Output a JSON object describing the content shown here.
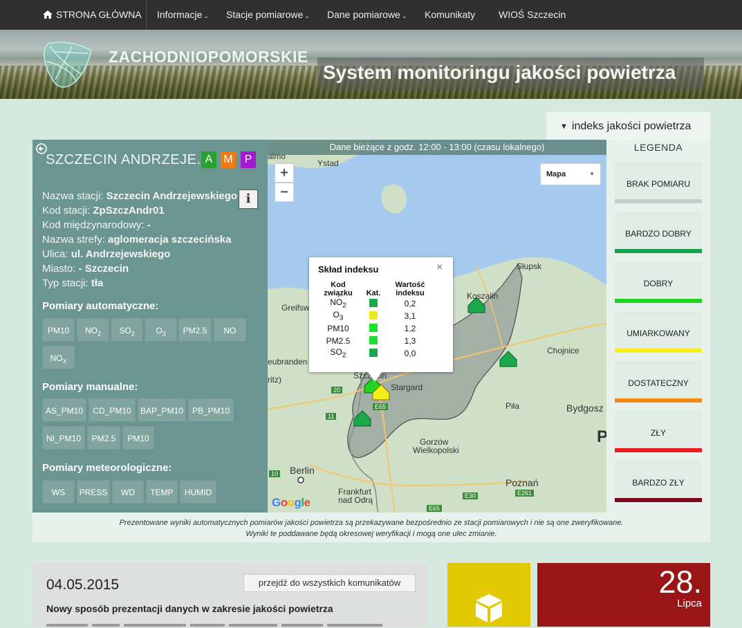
{
  "nav": {
    "home": "STRONA GŁÓWNA",
    "items": [
      {
        "label": "Informacje",
        "dropdown": true
      },
      {
        "label": "Stacje pomiarowe",
        "dropdown": true
      },
      {
        "label": "Dane pomiarowe",
        "dropdown": true
      },
      {
        "label": "Komunikaty",
        "dropdown": false
      },
      {
        "label": "WIOŚ Szczecin",
        "dropdown": false
      }
    ]
  },
  "banner": {
    "brand": "ZACHODNIOPOMORSKIE",
    "subtitle": "System monitoringu jakości powietrza"
  },
  "index_tab": {
    "label": "indeks jakości powietrza"
  },
  "station": {
    "title": "SZCZECIN ANDRZEJE...",
    "badges": [
      {
        "label": "A",
        "color": "#27a22e"
      },
      {
        "label": "M",
        "color": "#f07a16"
      },
      {
        "label": "P",
        "color": "#a419d6"
      }
    ],
    "info_label": "i",
    "fields": [
      {
        "label": "Nazwa stacji:",
        "value": "Szczecin Andrzejewskiego"
      },
      {
        "label": "Kod stacji:",
        "value": "ZpSzczAndr01"
      },
      {
        "label": "Kod międzynarodowy:",
        "value": "-"
      },
      {
        "label": "Nazwa strefy:",
        "value": "aglomeracja szczecińska"
      },
      {
        "label": "Ulica:",
        "value": "ul. Andrzejewskiego"
      },
      {
        "label": "Miasto:",
        "value": "- Szczecin"
      },
      {
        "label": "Typ stacji:",
        "value": "tła"
      }
    ],
    "auto_title": "Pomiary automatyczne:",
    "auto": [
      "PM10",
      "NO",
      "SO",
      "O",
      "PM2.5",
      "NO",
      "NO"
    ],
    "auto_subs": [
      "",
      "2",
      "2",
      "3",
      "",
      "",
      "X"
    ],
    "manual_title": "Pomiary manualne:",
    "manual": [
      "AS_PM10",
      "CD_PM10",
      "BAP_PM10",
      "PB_PM10",
      "NI_PM10",
      "PM2.5",
      "PM10"
    ],
    "meteo_title": "Pomiary meteorologiczne:",
    "meteo": [
      "WS",
      "PRESS",
      "WD",
      "TEMP",
      "HUMID"
    ]
  },
  "map": {
    "header": "Dane bieżące z godz. 12:00 - 13:00 (czasu lokalnego)",
    "zoom_in": "+",
    "zoom_out": "−",
    "map_type": "Mapa",
    "labels": [
      "almo",
      "Ystad",
      "Słupsk",
      "Koszalin",
      "Greifsw",
      "Chojnice",
      "eubranden",
      "Szczecin",
      "Stargard",
      "ritz)",
      "Piła",
      "Bydgosz",
      "Gorzów",
      "Wielkopolski",
      "Berlin",
      "Frankfurt",
      "nad Odrą",
      "Poznań",
      "P"
    ],
    "road_labels": [
      "20",
      "11",
      "E65",
      "10",
      "E65",
      "E30",
      "E261"
    ],
    "google": [
      "G",
      "o",
      "o",
      "g",
      "l",
      "e"
    ],
    "popup": {
      "title": "Skład indeksu",
      "close": "×",
      "headers": [
        "Kod związku",
        "Kat.",
        "Wartość indeksu"
      ],
      "rows": [
        {
          "code": "NO",
          "sub": "2",
          "color": "#1aa84b",
          "value": "0,2"
        },
        {
          "code": "O",
          "sub": "3",
          "color": "#ecea1a",
          "value": "3,1"
        },
        {
          "code": "PM10",
          "sub": "",
          "color": "#1ee12c",
          "value": "1,2"
        },
        {
          "code": "PM2.5",
          "sub": "",
          "color": "#1ee12c",
          "value": "1,3"
        },
        {
          "code": "SO",
          "sub": "2",
          "color": "#1aa84b",
          "value": "0,0"
        }
      ]
    }
  },
  "legend": {
    "title": "LEGENDA",
    "items": [
      {
        "label": "BRAK POMIARU",
        "color": "#c6cccb"
      },
      {
        "label": "BARDZO DOBRY",
        "color": "#12a34a"
      },
      {
        "label": "DOBRY",
        "color": "#20d520"
      },
      {
        "label": "UMIARKOWANY",
        "color": "#f5ee18"
      },
      {
        "label": "DOSTATECZNY",
        "color": "#f28a14"
      },
      {
        "label": "ZŁY",
        "color": "#ee1d1d"
      },
      {
        "label": "BARDZO ZŁY",
        "color": "#7b0a1f"
      }
    ]
  },
  "note": {
    "line1": "Prezentowane wyniki automatycznych pomiarów jakości powietrza są przekazywane bezpośrednio ze stacji pomiarowych i nie są one zweryfikowane.",
    "line2": "Wyniki te poddawane będą okresowej weryfikacji i mogą one ulec zmianie."
  },
  "news": {
    "date": "04.05.2015",
    "all_button": "przejdź do wszystkich komunikatów",
    "headline": "Nowy sposób prezentacji danych w zakresie jakości powietrza"
  },
  "calendar": {
    "day": "28.",
    "month": "Lipca"
  }
}
